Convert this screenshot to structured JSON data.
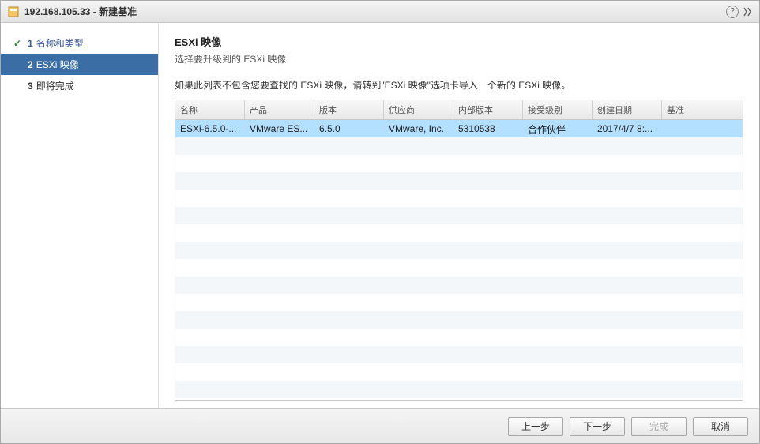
{
  "titlebar": {
    "title": "192.168.105.33 - 新建基准"
  },
  "sidebar": {
    "steps": [
      {
        "num": "1",
        "label": "名称和类型",
        "state": "done"
      },
      {
        "num": "2",
        "label": "ESXi 映像",
        "state": "active"
      },
      {
        "num": "3",
        "label": "即将完成",
        "state": "pending"
      }
    ]
  },
  "main": {
    "heading": "ESXi 映像",
    "subheading": "选择要升级到的 ESXi 映像",
    "description": "如果此列表不包含您要查找的 ESXi 映像，请转到\"ESXi 映像\"选项卡导入一个新的 ESXi 映像。",
    "columns": [
      "名称",
      "产品",
      "版本",
      "供应商",
      "内部版本",
      "接受级别",
      "创建日期",
      "基准"
    ],
    "rows": [
      {
        "cells": [
          "ESXi-6.5.0-...",
          "VMware ES...",
          "6.5.0",
          "VMware, Inc.",
          "5310538",
          "合作伙伴",
          "2017/4/7 8:...",
          ""
        ],
        "selected": true
      }
    ],
    "empty_row_count": 16
  },
  "footer": {
    "back": "上一步",
    "next": "下一步",
    "finish": "完成",
    "cancel": "取消"
  }
}
